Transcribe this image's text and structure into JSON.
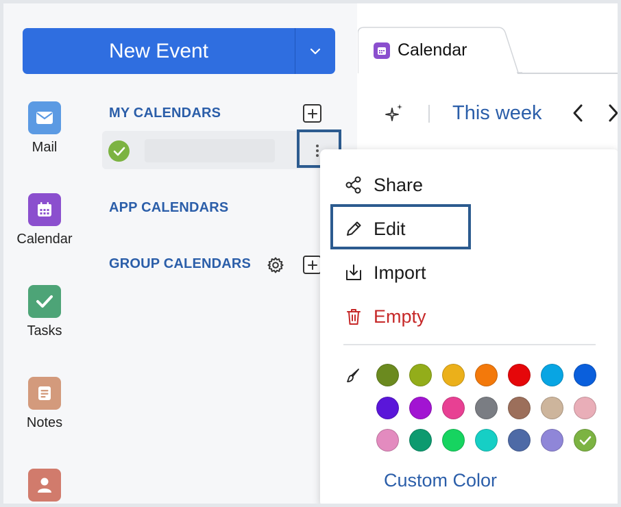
{
  "new_event": {
    "label": "New Event"
  },
  "apps": [
    {
      "label": "Mail",
      "icon": "mail-icon",
      "color": "#5b9ae3"
    },
    {
      "label": "Calendar",
      "icon": "calendar-icon",
      "color": "#8b4fce"
    },
    {
      "label": "Tasks",
      "icon": "tasks-icon",
      "color": "#4da477"
    },
    {
      "label": "Notes",
      "icon": "notes-icon",
      "color": "#d39a7c"
    },
    {
      "label": "",
      "icon": "contacts-icon",
      "color": "#d17b6c"
    }
  ],
  "sections": {
    "my_calendars": "MY CALENDARS",
    "app_calendars": "APP CALENDARS",
    "group_calendars": "GROUP CALENDARS"
  },
  "calendar_item": {
    "selected_color": "#7cb342"
  },
  "tab": {
    "label": "Calendar"
  },
  "toolbar": {
    "range_label": "This week"
  },
  "menu": {
    "share": "Share",
    "edit": "Edit",
    "import": "Import",
    "empty": "Empty",
    "empty_color": "#c62828",
    "custom_color": "Custom Color"
  },
  "swatches": [
    "#6b8a1f",
    "#93ad1a",
    "#ebb01a",
    "#f3790b",
    "#e5070a",
    "#08a5e3",
    "#0a5fdc",
    "#5a16d9",
    "#a214d2",
    "#e84093",
    "#7a7d83",
    "#9c6f5b",
    "#cdb59c",
    "#e9aeb8",
    "#e38bbf",
    "#0d9a6f",
    "#16d460",
    "#16cfc5",
    "#4e6aa6",
    "#8f86d8",
    "#7cb342"
  ],
  "selected_swatch_index": 20,
  "accent": "#2f6ee0",
  "highlight": "#2c5b8f"
}
